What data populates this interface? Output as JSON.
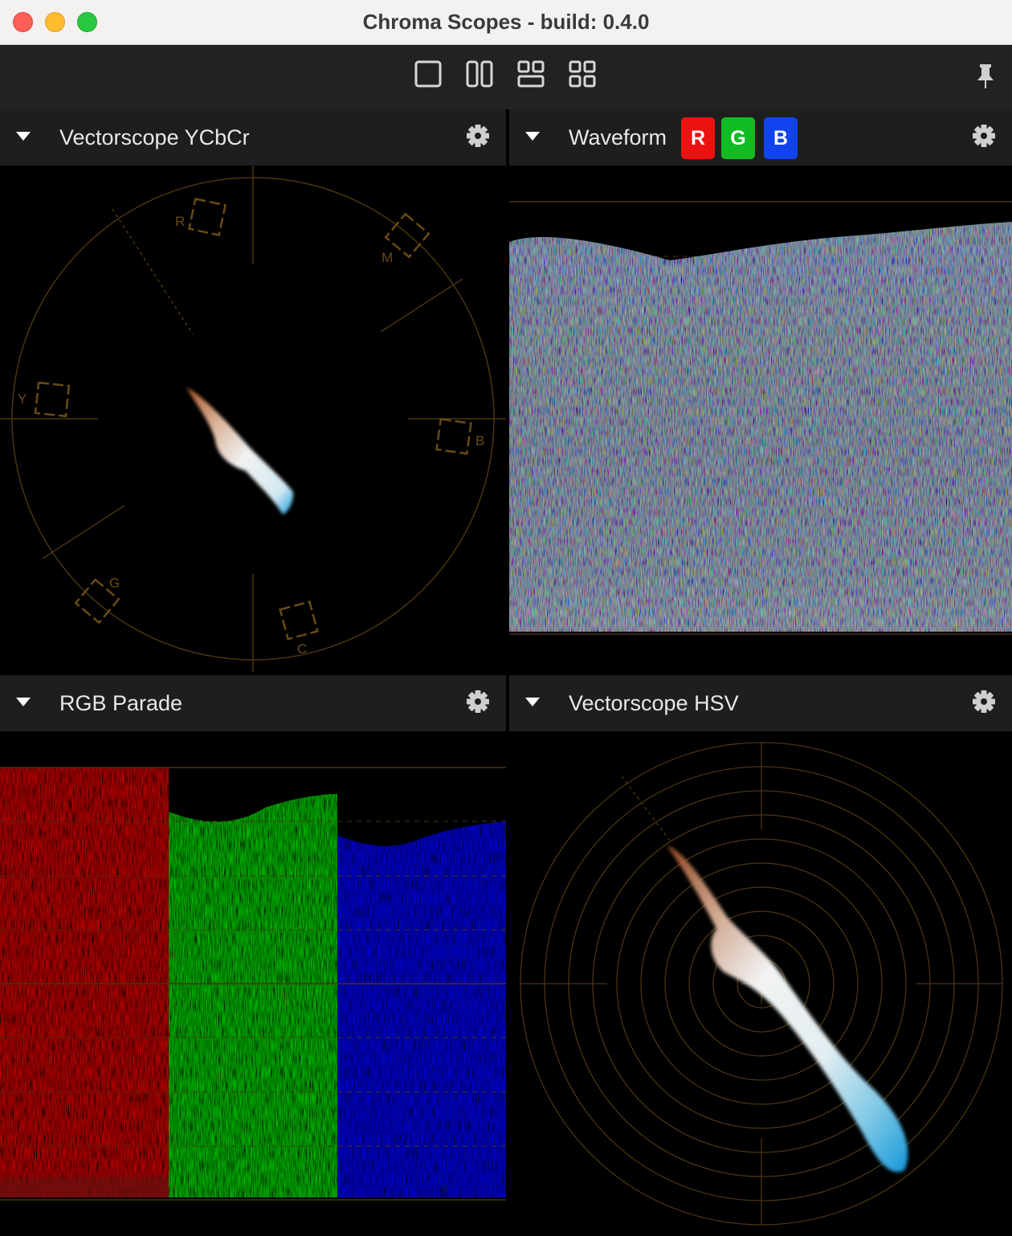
{
  "window": {
    "title": "Chroma Scopes - build: 0.4.0"
  },
  "toolbar": {
    "layouts": [
      {
        "name": "single-layout",
        "icon": "single-square-icon"
      },
      {
        "name": "two-column-layout",
        "icon": "two-columns-icon"
      },
      {
        "name": "three-panel-layout",
        "icon": "three-panel-icon"
      },
      {
        "name": "four-grid-layout",
        "icon": "four-grid-icon"
      }
    ],
    "pin_icon": "pin-icon"
  },
  "panels": {
    "vectorscope_ycbcr": {
      "title": "Vectorscope YCbCr",
      "targets": {
        "r": "R",
        "m": "M",
        "b": "B",
        "c": "C",
        "g": "G",
        "y": "Y"
      }
    },
    "waveform": {
      "title": "Waveform",
      "channels": [
        {
          "label": "R",
          "color": "#ee1111"
        },
        {
          "label": "G",
          "color": "#11bb22"
        },
        {
          "label": "B",
          "color": "#1144ee"
        }
      ]
    },
    "rgb_parade": {
      "title": "RGB Parade"
    },
    "vectorscope_hsv": {
      "title": "Vectorscope HSV"
    }
  },
  "colors": {
    "graticule": "#4a3410",
    "label": "#6a4a16",
    "header_bg": "#1e1e1e",
    "toolbar_bg": "#222222"
  }
}
